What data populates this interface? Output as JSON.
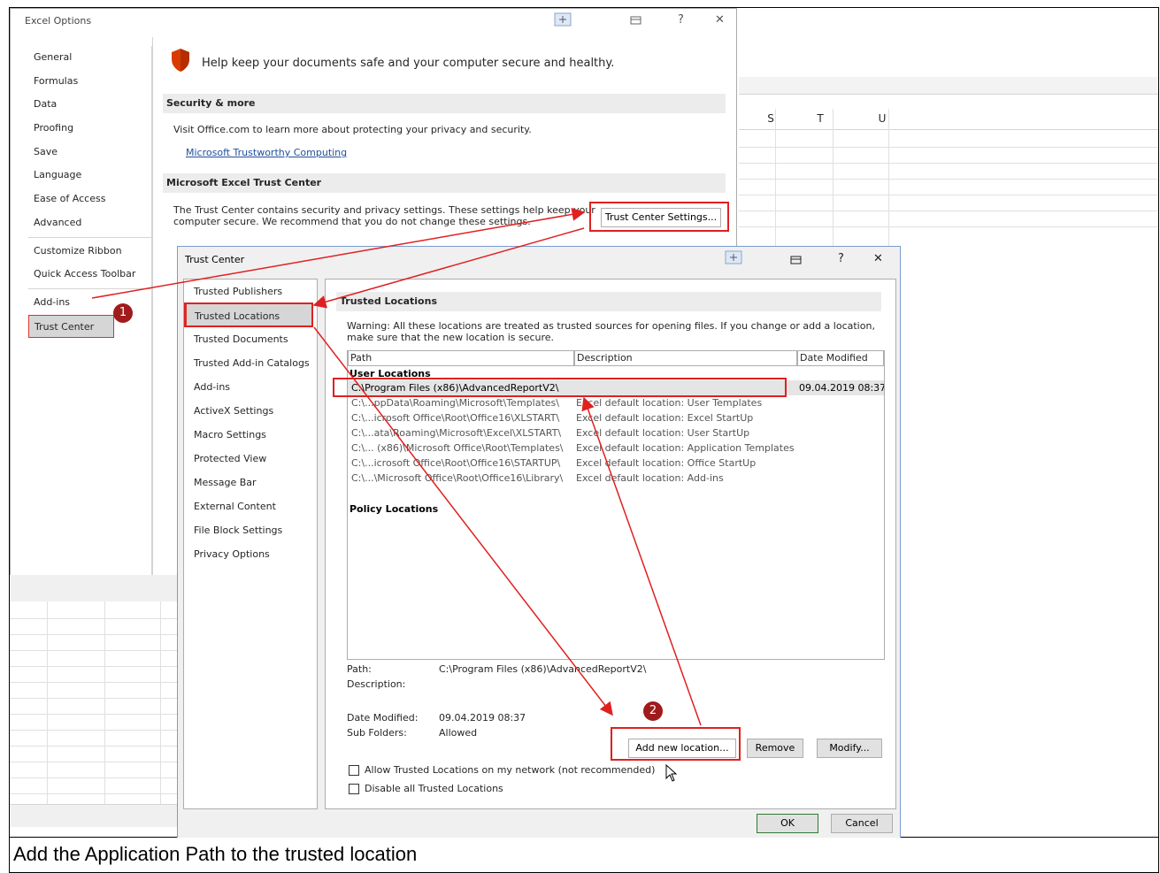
{
  "caption": "Add the Application Path to the trusted location",
  "excel_grid": {
    "columns": [
      "S",
      "T",
      "U"
    ]
  },
  "options_dialog": {
    "title": "Excel Options",
    "nav": [
      "General",
      "Formulas",
      "Data",
      "Proofing",
      "Save",
      "Language",
      "Ease of Access",
      "Advanced",
      "Customize Ribbon",
      "Quick Access Toolbar",
      "Add-ins",
      "Trust Center"
    ],
    "selected_nav": "Trust Center",
    "headline": "Help keep your documents safe and your computer secure and healthy.",
    "security_section": "Security & more",
    "security_text": "Visit Office.com to learn more about protecting your privacy and security.",
    "security_link": "Microsoft Trustworthy Computing",
    "trust_section": "Microsoft Excel Trust Center",
    "trust_text_1": "The Trust Center contains security and privacy settings. These settings help keep your",
    "trust_text_2": "computer secure. We recommend that you do not change these settings.",
    "trust_button": "Trust Center Settings...",
    "help_glyph": "?",
    "close_glyph": "✕"
  },
  "trust_center": {
    "title": "Trust Center",
    "nav": [
      "Trusted Publishers",
      "Trusted Locations",
      "Trusted Documents",
      "Trusted Add-in Catalogs",
      "Add-ins",
      "ActiveX Settings",
      "Macro Settings",
      "Protected View",
      "Message Bar",
      "External Content",
      "File Block Settings",
      "Privacy Options"
    ],
    "selected_nav": "Trusted Locations",
    "section_title": "Trusted Locations",
    "warning": "Warning: All these locations are treated as trusted sources for opening files.  If you change or add a location, make sure that the new location is secure.",
    "columns": {
      "path": "Path",
      "description": "Description",
      "date": "Date Modified"
    },
    "user_locations_label": "User Locations",
    "user_locations": [
      {
        "path": "C:\\Program Files (x86)\\AdvancedReportV2\\",
        "description": "",
        "date": "09.04.2019 08:37"
      },
      {
        "path": "C:\\...ppData\\Roaming\\Microsoft\\Templates\\",
        "description": "Excel default location: User Templates",
        "date": ""
      },
      {
        "path": "C:\\...icrosoft Office\\Root\\Office16\\XLSTART\\",
        "description": "Excel default location: Excel StartUp",
        "date": ""
      },
      {
        "path": "C:\\...ata\\Roaming\\Microsoft\\Excel\\XLSTART\\",
        "description": "Excel default location: User StartUp",
        "date": ""
      },
      {
        "path": "C:\\... (x86)\\Microsoft Office\\Root\\Templates\\",
        "description": "Excel default location: Application Templates",
        "date": ""
      },
      {
        "path": "C:\\...icrosoft Office\\Root\\Office16\\STARTUP\\",
        "description": "Excel default location: Office StartUp",
        "date": ""
      },
      {
        "path": "C:\\...\\Microsoft Office\\Root\\Office16\\Library\\",
        "description": "Excel default location: Add-ins",
        "date": ""
      }
    ],
    "policy_locations_label": "Policy Locations",
    "details": {
      "path_label": "Path:",
      "path_value": "C:\\Program Files (x86)\\AdvancedReportV2\\",
      "description_label": "Description:",
      "date_label": "Date Modified:",
      "date_value": "09.04.2019 08:37",
      "subfolders_label": "Sub Folders:",
      "subfolders_value": "Allowed"
    },
    "buttons": {
      "add": "Add new location...",
      "remove": "Remove",
      "modify": "Modify...",
      "ok": "OK",
      "cancel": "Cancel"
    },
    "checkbox_network": "Allow Trusted Locations on my network (not recommended)",
    "checkbox_disable": "Disable all Trusted Locations",
    "help_glyph": "?",
    "close_glyph": "✕"
  },
  "badges": [
    "1",
    "2"
  ]
}
